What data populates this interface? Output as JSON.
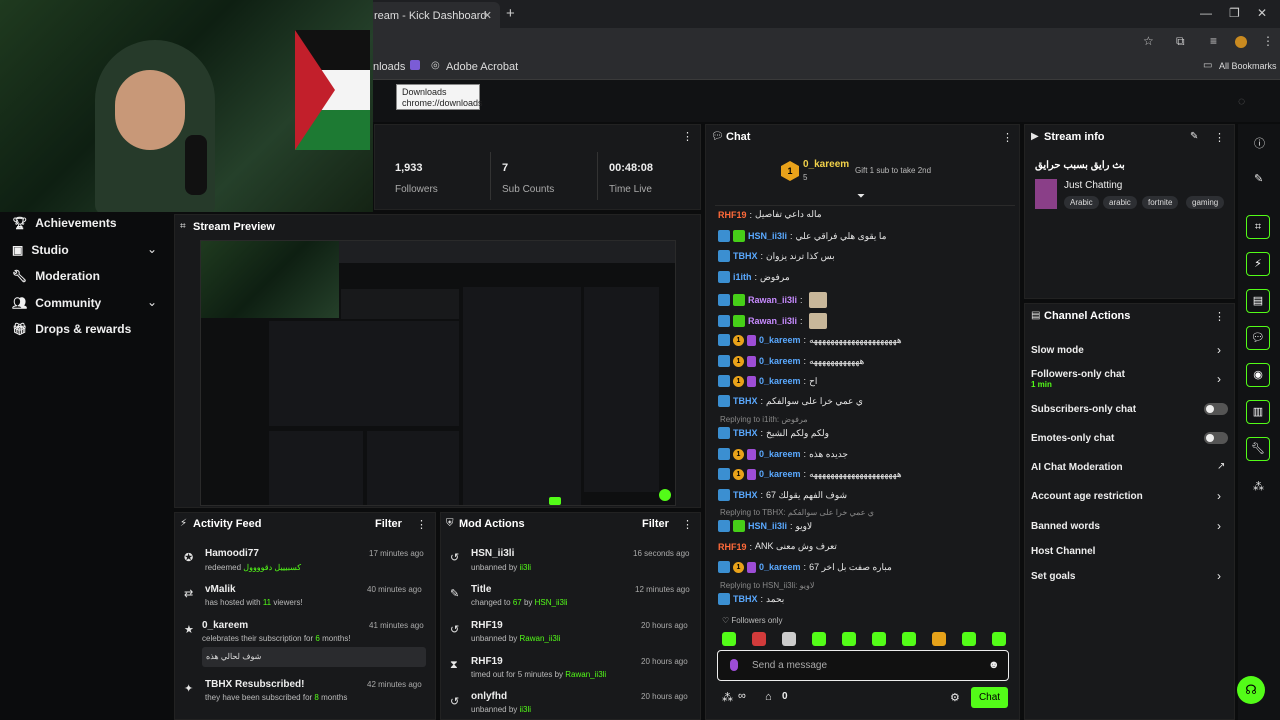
{
  "browser": {
    "tab_title": "ream - Kick Dashboard",
    "new_tab": "+",
    "bookmarks": {
      "downloads": "nloads",
      "acrobat": "Adobe Acrobat",
      "all": "All Bookmarks"
    },
    "tooltip": {
      "line1": "Downloads",
      "line2": "chrome://downloads"
    }
  },
  "sidebar": {
    "items": [
      {
        "label": "Achievements",
        "icon": "trophy-icon"
      },
      {
        "label": "Studio",
        "icon": "studio-icon"
      },
      {
        "label": "Moderation",
        "icon": "wrench-icon"
      },
      {
        "label": "Community",
        "icon": "people-icon"
      },
      {
        "label": "Drops & rewards",
        "icon": "gift-icon"
      }
    ]
  },
  "stats": [
    {
      "value": "1,933",
      "label": "Followers"
    },
    {
      "value": "7",
      "label": "Sub Counts"
    },
    {
      "value": "00:48:08",
      "label": "Time Live"
    }
  ],
  "stream_preview": {
    "title": "Stream Preview"
  },
  "activity_feed": {
    "title": "Activity Feed",
    "filter": "Filter",
    "items": [
      {
        "name": "Hamoodi77",
        "time": "17 minutes ago",
        "text": "redeemed",
        "highlight": "كسبيييل دقوووول"
      },
      {
        "name": "vMalik",
        "time": "40 minutes ago",
        "text": "has hosted with",
        "highlight": "11",
        "suffix": "viewers!"
      },
      {
        "name": "0_kareem",
        "time": "41 minutes ago",
        "text": "celebrates their subscription for",
        "highlight": "6",
        "suffix": "months!",
        "message": "شوف لحالي هذه"
      },
      {
        "name": "TBHX Resubscribed!",
        "time": "42 minutes ago",
        "text": "they have been subscribed for",
        "highlight": "8",
        "suffix": "months"
      }
    ]
  },
  "mod_actions": {
    "title": "Mod Actions",
    "filter": "Filter",
    "items": [
      {
        "name": "HSN_ii3li",
        "time": "16 seconds ago",
        "text": "unbanned by",
        "by": "ii3li"
      },
      {
        "name": "Title",
        "time": "12 minutes ago",
        "text": "changed to",
        "value": "67",
        "by_label": "by",
        "by": "HSN_ii3li"
      },
      {
        "name": "RHF19",
        "time": "20 hours ago",
        "text": "unbanned by",
        "by": "Rawan_ii3li"
      },
      {
        "name": "RHF19",
        "time": "20 hours ago",
        "text": "timed out for 5 minutes by",
        "by": "Rawan_ii3li"
      },
      {
        "name": "onlyfhd",
        "time": "20 hours ago",
        "text": "unbanned by",
        "by": "ii3li"
      }
    ]
  },
  "chat": {
    "title": "Chat",
    "pinned": {
      "user": "0_kareem",
      "count": "5",
      "gift": "Gift 1 sub to take 2nd"
    },
    "messages": [
      {
        "user": "RHF19",
        "color": "r",
        "text": "ماله داعي تفاصيل"
      },
      {
        "user": "HSN_ii3li",
        "color": "b",
        "text": "ما يقوى هلي فراقي علي"
      },
      {
        "user": "TBHX",
        "color": "b",
        "text": "بس كذا ترند يزوان"
      },
      {
        "user": "i1ith",
        "color": "b",
        "text": "مرفوض"
      },
      {
        "user": "Rawan_ii3li",
        "color": "p",
        "text": ""
      },
      {
        "user": "Rawan_ii3li",
        "color": "p",
        "text": ""
      },
      {
        "user": "0_kareem",
        "color": "b",
        "text": "هههههههههههههههههههههه"
      },
      {
        "user": "0_kareem",
        "color": "b",
        "text": "ههههههههههههه"
      },
      {
        "user": "0_kareem",
        "color": "b",
        "text": "اح"
      },
      {
        "user": "TBHX",
        "color": "b",
        "text": "ي عمي خرا على سوالفكم"
      },
      {
        "reply": "Replying to i1ith: مرفوض"
      },
      {
        "user": "TBHX",
        "color": "b",
        "text": "ولكم ولكم الشيخ"
      },
      {
        "user": "0_kareem",
        "color": "b",
        "text": "جديده هذه"
      },
      {
        "user": "0_kareem",
        "color": "b",
        "text": "هههههههههههههههههههههه"
      },
      {
        "user": "TBHX",
        "color": "b",
        "text": "شوف الفهم يقولك 67"
      },
      {
        "reply": "Replying to TBHX: ي عمي خرا على سوالفكم"
      },
      {
        "user": "HSN_ii3li",
        "color": "b",
        "text": "لاويو"
      },
      {
        "user": "RHF19",
        "color": "r",
        "text": "ANK تعرف وش معنى"
      },
      {
        "user": "0_kareem",
        "color": "b",
        "text": "مباره صفت بل اخر 67"
      },
      {
        "reply": "Replying to HSN_ii3li: لاويو"
      },
      {
        "user": "TBHX",
        "color": "b",
        "text": "بحمد"
      }
    ],
    "followers_only": "Followers only",
    "input_placeholder": "Send a message",
    "points": "0",
    "infinity": "∞",
    "send": "Chat"
  },
  "stream_info": {
    "title": "Stream info",
    "stream_title": "بث رايق بسبب حرايق",
    "category": "Just Chatting",
    "tags": [
      "Arabic",
      "arabic",
      "fortnite",
      "gaming"
    ]
  },
  "channel_actions": {
    "title": "Channel Actions",
    "rows": [
      {
        "label": "Slow mode"
      },
      {
        "label": "Followers-only chat",
        "sub": "1 min"
      },
      {
        "label": "Subscribers-only chat"
      },
      {
        "label": "Emotes-only chat"
      },
      {
        "label": "AI Chat Moderation"
      },
      {
        "label": "Account age restriction"
      },
      {
        "label": "Banned words"
      },
      {
        "label": "Host Channel"
      },
      {
        "label": "Set goals"
      }
    ]
  },
  "colors": {
    "accent": "#53fc18",
    "panel": "#18191b",
    "background": "#0b0c0d"
  }
}
